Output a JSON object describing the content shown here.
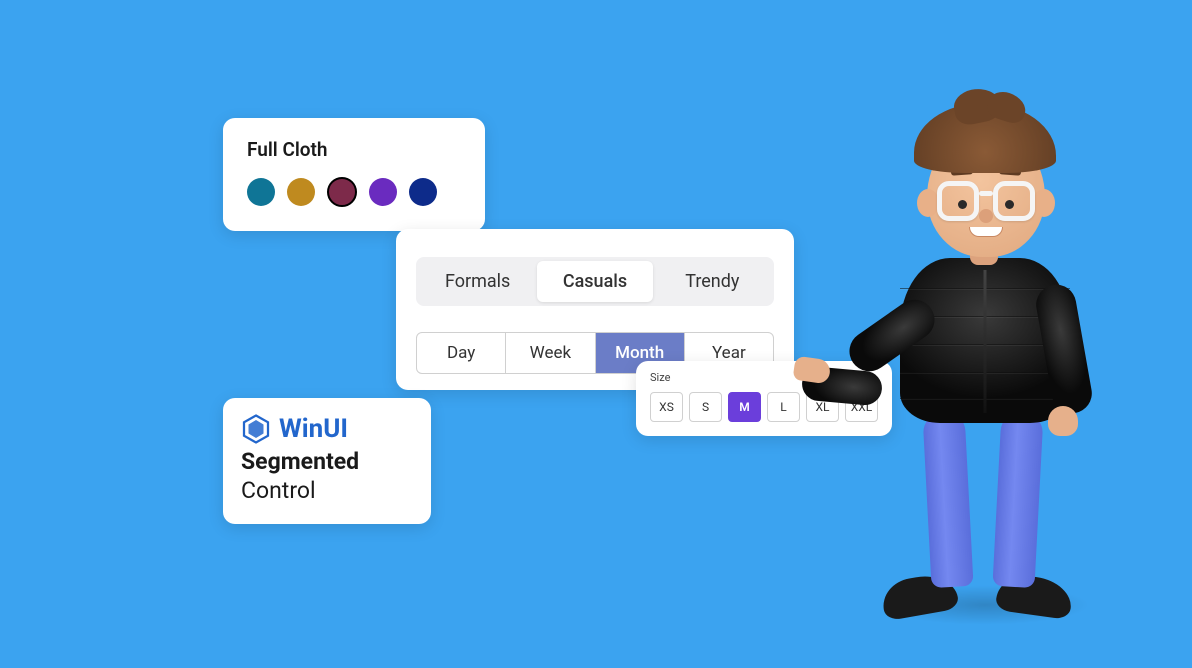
{
  "fullcloth": {
    "title": "Full Cloth",
    "colors": [
      {
        "hex": "#0f7596",
        "selected": false
      },
      {
        "hex": "#bf8a1f",
        "selected": false
      },
      {
        "hex": "#7d2a4a",
        "selected": true
      },
      {
        "hex": "#6a2bbf",
        "selected": false
      },
      {
        "hex": "#0d2b8a",
        "selected": false
      }
    ]
  },
  "styleSegment": {
    "items": [
      "Formals",
      "Casuals",
      "Trendy"
    ],
    "selected": "Casuals"
  },
  "periodSegment": {
    "items": [
      "Day",
      "Week",
      "Month",
      "Year"
    ],
    "selected": "Month"
  },
  "sizePanel": {
    "label": "Size",
    "items": [
      "XS",
      "S",
      "M",
      "L",
      "XL",
      "XXL"
    ],
    "selected": "M"
  },
  "titleCard": {
    "brand": "WinUI",
    "line1": "Segmented",
    "line2": "Control"
  }
}
